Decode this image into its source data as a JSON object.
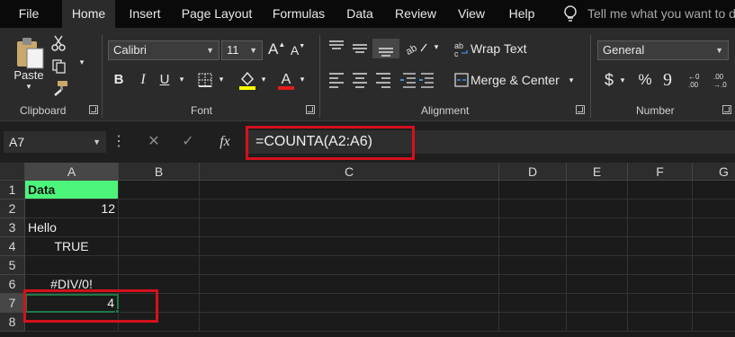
{
  "tabs": [
    "File",
    "Home",
    "Insert",
    "Page Layout",
    "Formulas",
    "Data",
    "Review",
    "View",
    "Help"
  ],
  "active_tab": "Home",
  "tell_me": "Tell me what you want to do",
  "ribbon": {
    "clipboard": {
      "paste_label": "Paste",
      "group_label": "Clipboard"
    },
    "font": {
      "name": "Calibri",
      "size": "11",
      "grow": "A",
      "shrink": "A",
      "bold": "B",
      "italic": "I",
      "underline": "U",
      "group_label": "Font"
    },
    "alignment": {
      "wrap_text": "Wrap Text",
      "merge_center": "Merge & Center",
      "group_label": "Alignment"
    },
    "number": {
      "format": "General",
      "currency": "$",
      "percent": "%",
      "comma": "9",
      "group_label": "Number"
    }
  },
  "formula_bar": {
    "name_box": "A7",
    "more": "⋮",
    "cancel": "✕",
    "enter": "✓",
    "fx": "fx",
    "formula": "=COUNTA(A2:A6)"
  },
  "grid": {
    "columns": [
      "A",
      "B",
      "C",
      "D",
      "E",
      "F",
      "G"
    ],
    "rows": [
      "1",
      "2",
      "3",
      "4",
      "5",
      "6",
      "7",
      "8"
    ],
    "cells": {
      "A1": "Data",
      "A2": "12",
      "A3": "Hello",
      "A4": "TRUE",
      "A5": "",
      "A6": "#DIV/0!",
      "A7": "4"
    },
    "header_fill_color": "#4cf57a",
    "selection_color": "#1f7a45",
    "highlight_color": "#d4111c"
  }
}
